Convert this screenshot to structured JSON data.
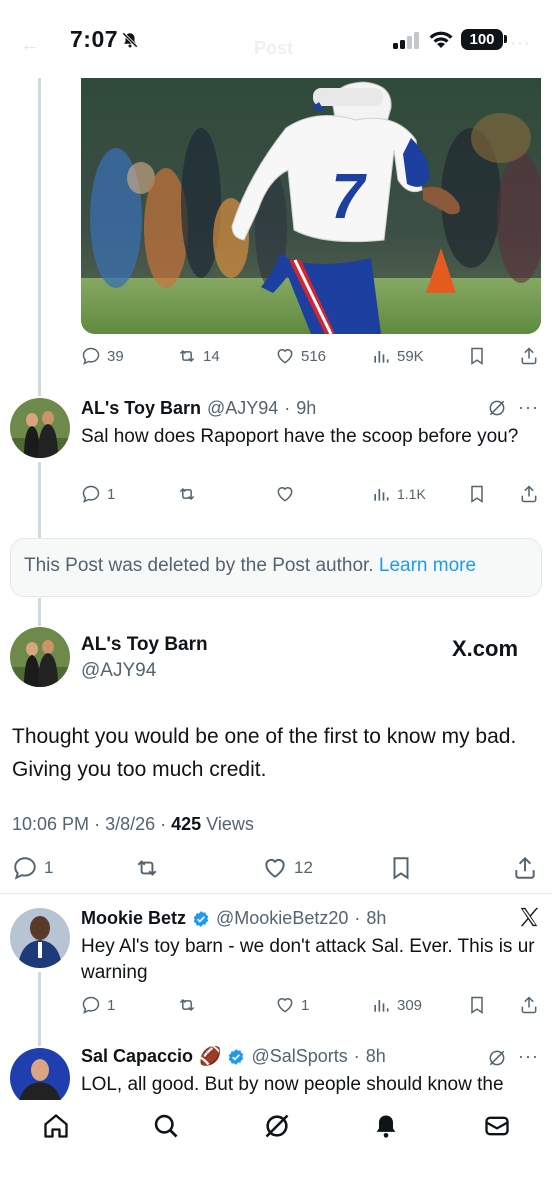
{
  "status_bar": {
    "time": "7:07",
    "battery": "100"
  },
  "faint_header": {
    "title": "Post"
  },
  "top_post_actions": {
    "replies": "39",
    "reposts": "14",
    "likes": "516",
    "views": "59K"
  },
  "reply1": {
    "name": "AL's Toy Barn",
    "handle": "@AJY94",
    "time": "9h",
    "text": "Sal how does Rapoport have the scoop before you?",
    "replies": "1",
    "views": "1.1K"
  },
  "deleted_notice": {
    "text": "This Post was deleted by the Post author.",
    "link": "Learn more"
  },
  "main_post": {
    "name": "AL's Toy Barn",
    "handle": "@AJY94",
    "brand": "X.com",
    "text": "Thought you would be one of the first to know my bad. Giving you too much credit.",
    "time": "10:06 PM",
    "date": "3/8/26",
    "views_count": "425",
    "views_label": "Views",
    "replies": "1",
    "likes": "12"
  },
  "reply2": {
    "name": "Mookie Betz",
    "handle": "@MookieBetz20",
    "time": "8h",
    "text": "Hey Al's toy barn - we don't attack Sal. Ever. This is ur warning",
    "replies": "1",
    "likes": "1",
    "views": "309"
  },
  "reply3": {
    "name": "Sal Capaccio",
    "emoji": "🏈",
    "handle": "@SalSports",
    "time": "8h",
    "text": "LOL, all good.  But by now people should know the"
  },
  "colors": {
    "accent": "#1d9bf0",
    "text_secondary": "#536471",
    "text_primary": "#0f1419",
    "bills_blue": "#1d3fa0",
    "bills_red": "#d32431"
  },
  "icons": [
    "bell-off-icon",
    "signal-icon",
    "wifi-icon",
    "battery-icon",
    "reply-icon",
    "repost-icon",
    "like-icon",
    "views-icon",
    "bookmark-icon",
    "share-icon",
    "grok-icon",
    "more-icon",
    "verified-icon",
    "x-logo-icon",
    "home-icon",
    "search-icon",
    "notifications-icon",
    "messages-icon"
  ]
}
